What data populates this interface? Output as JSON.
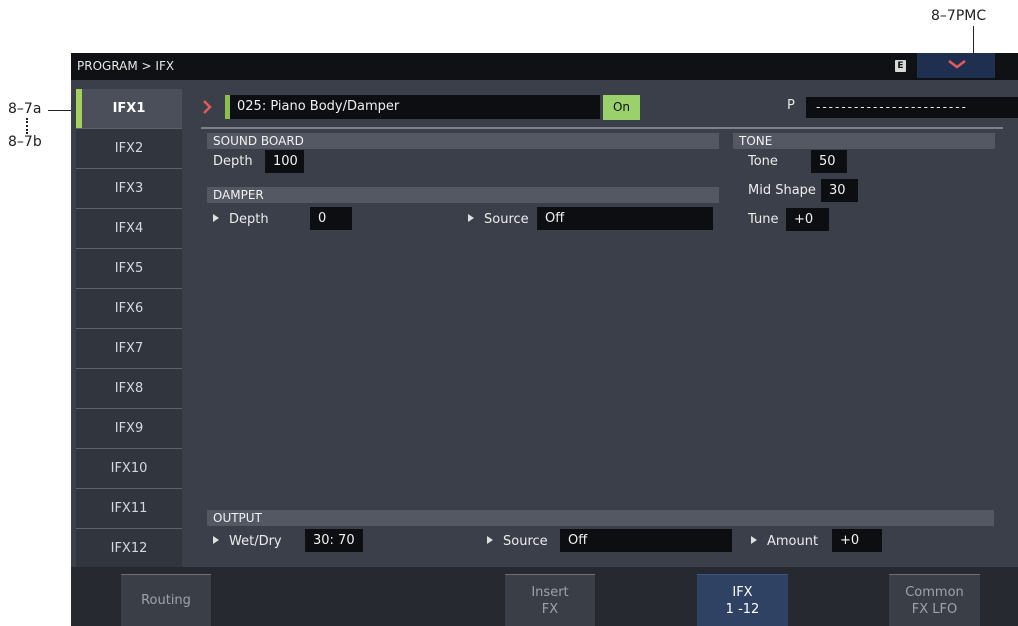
{
  "callouts": {
    "top_right": "8–7PMC",
    "left_a": "8–7a",
    "left_b": "8–7b"
  },
  "title": "PROGRAM > IFX",
  "edit_badge": "E",
  "menu_icon": "chevron-down-icon",
  "tabs": [
    {
      "label": "IFX1",
      "selected": true
    },
    {
      "label": "IFX2"
    },
    {
      "label": "IFX3"
    },
    {
      "label": "IFX4"
    },
    {
      "label": "IFX5"
    },
    {
      "label": "IFX6"
    },
    {
      "label": "IFX7"
    },
    {
      "label": "IFX8"
    },
    {
      "label": "IFX9"
    },
    {
      "label": "IFX10"
    },
    {
      "label": "IFX11"
    },
    {
      "label": "IFX12"
    }
  ],
  "effect": {
    "name": "025: Piano Body/Damper",
    "on_label": "On",
    "p_label": "P",
    "p_value": "------------------------"
  },
  "sound_board": {
    "header": "SOUND BOARD",
    "depth_label": "Depth",
    "depth_value": "100"
  },
  "damper": {
    "header": "DAMPER",
    "depth_label": "Depth",
    "depth_value": "0",
    "source_label": "Source",
    "source_value": "Off"
  },
  "tone": {
    "header": "TONE",
    "tone_label": "Tone",
    "tone_value": "50",
    "mid_shape_label": "Mid Shape",
    "mid_shape_value": "30",
    "tune_label": "Tune",
    "tune_value": "+0"
  },
  "output": {
    "header": "OUTPUT",
    "wetdry_label": "Wet/Dry",
    "wetdry_value": "30: 70",
    "source_label": "Source",
    "source_value": "Off",
    "amount_label": "Amount",
    "amount_value": "+0"
  },
  "bottom_tabs": [
    {
      "label": "Routing"
    },
    {
      "label": "Insert\nFX"
    },
    {
      "label": "IFX\n1 -12",
      "active": true
    },
    {
      "label": "Common\nFX LFO"
    }
  ],
  "colors": {
    "accent_green": "#9ad16a",
    "active_tab_blue": "#2f4264"
  }
}
